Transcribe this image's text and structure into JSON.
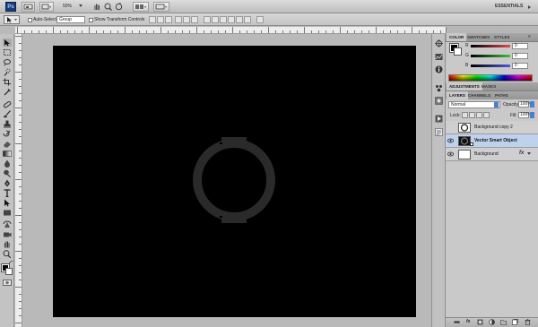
{
  "appbar": {
    "logo": "Ps",
    "zoom": "50%",
    "workspace": "ESSENTIALS"
  },
  "options": {
    "auto_select_label": "Auto-Select:",
    "auto_select_value": "Group",
    "transform_label": "Show Transform Controls"
  },
  "panels": {
    "color_tabs": [
      "COLOR",
      "SWATCHES",
      "STYLES"
    ],
    "channels": [
      {
        "label": "R",
        "value": "0",
        "color": "#e04a4a"
      },
      {
        "label": "G",
        "value": "0",
        "color": "#3fbf3f"
      },
      {
        "label": "B",
        "value": "0",
        "color": "#4a5ae0"
      }
    ],
    "adjust_tabs": [
      "ADJUSTMENTS",
      "MASKS"
    ],
    "layers_tabs": [
      "LAYERS",
      "CHANNELS",
      "PATHS"
    ],
    "blend_mode": "Normal",
    "opacity_label": "Opacity:",
    "opacity_value": "100%",
    "lock_label": "Lock:",
    "fill_label": "Fill:",
    "fill_value": "100%",
    "layers": [
      {
        "name": "Background copy 2",
        "selected": false
      },
      {
        "name": "Vector Smart Object",
        "selected": true
      },
      {
        "name": "Background",
        "selected": false,
        "fx": "fx"
      }
    ]
  },
  "colors": {
    "canvas": "#000000",
    "ring": "#2a2a2a",
    "selection": "#bed2ee"
  }
}
